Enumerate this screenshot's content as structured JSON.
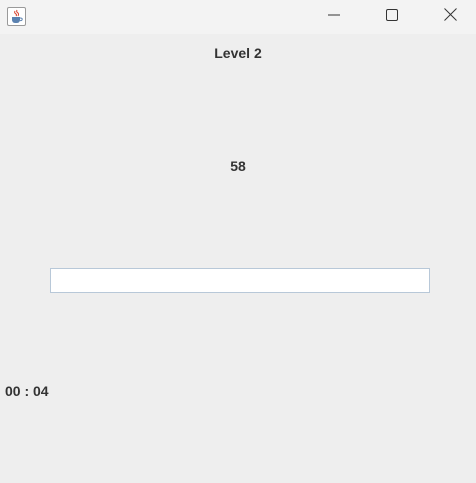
{
  "window": {
    "controls": {
      "minimize_icon": "minimize-icon",
      "maximize_icon": "maximize-icon",
      "close_icon": "close-icon"
    },
    "app_icon": "java-cup-icon"
  },
  "game": {
    "level_label": "Level 2",
    "number": "58",
    "answer_value": "",
    "timer": "00 : 04"
  },
  "colors": {
    "background": "#eeeeee",
    "titlebar": "#f3f3f3",
    "text": "#333333",
    "input_border": "#b8c8d8"
  }
}
